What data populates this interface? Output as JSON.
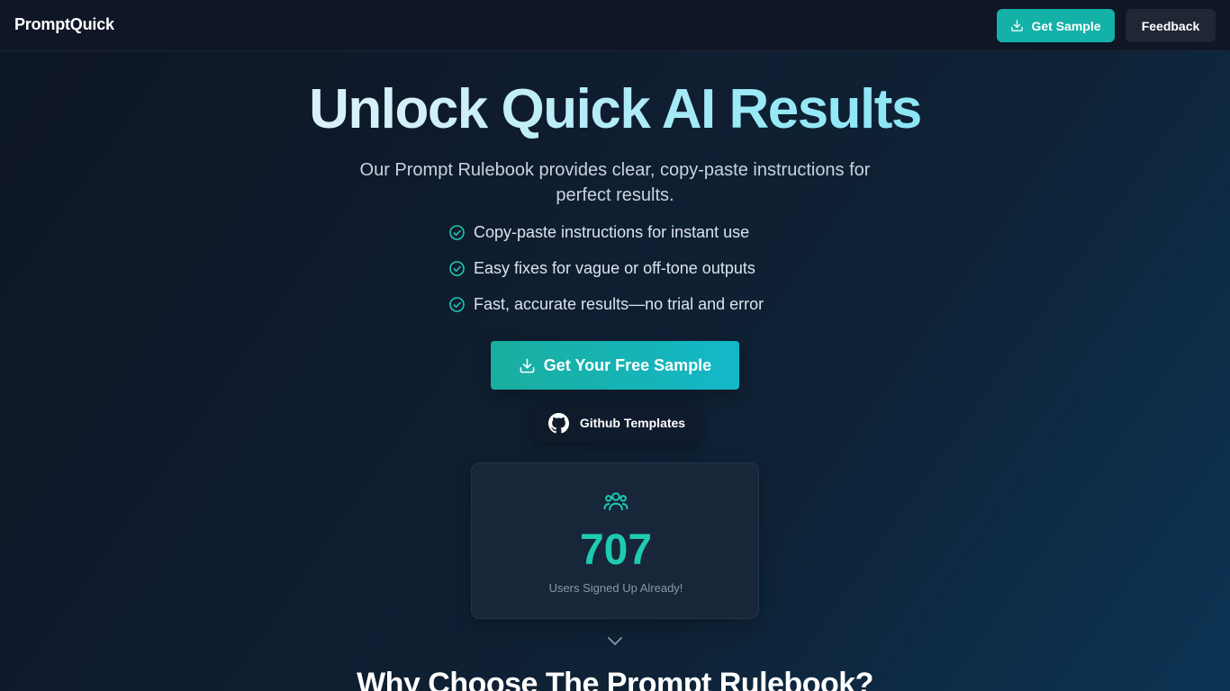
{
  "header": {
    "brand": "PromptQuick",
    "get_sample_label": "Get Sample",
    "feedback_label": "Feedback"
  },
  "hero": {
    "title": "Unlock Quick AI Results",
    "subtitle": "Our Prompt Rulebook provides clear, copy-paste instructions for perfect results.",
    "features": [
      "Copy-paste instructions for instant use",
      "Easy fixes for vague or off-tone outputs",
      "Fast, accurate results—no trial and error"
    ],
    "cta_label": "Get Your Free Sample",
    "github_label": "Github Templates"
  },
  "stats": {
    "count": "707",
    "label": "Users Signed Up Already!"
  },
  "next_section": {
    "title": "Why Choose The Prompt Rulebook?"
  },
  "colors": {
    "accent": "#14b1a8",
    "count": "#1ecbb0",
    "check": "#1ecbb0"
  },
  "icons": {
    "header_button": "download-icon",
    "cta": "download-icon",
    "github": "github-icon",
    "feature": "check-circle-icon",
    "stats": "users-icon",
    "scroll": "chevron-down-icon"
  }
}
